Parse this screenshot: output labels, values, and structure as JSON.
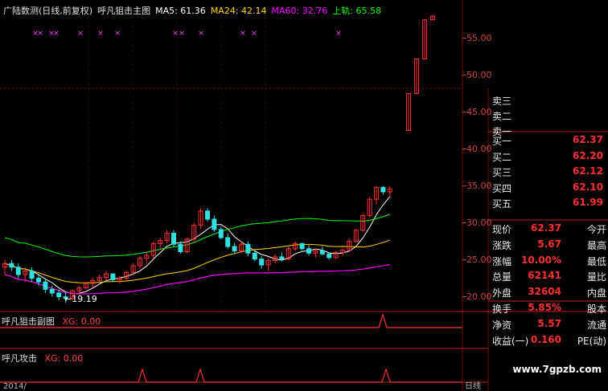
{
  "header": {
    "name": "广陆数测(日线,前复权)",
    "indicator": "呼凡狙击主图",
    "ma5": "MA5: 61.36",
    "ma24": "MA24: 42.14",
    "ma60": "MA60: 32.76",
    "upper": "上轨: 65.58"
  },
  "sub1": {
    "title": "呼凡狙击副图",
    "xg": "XG: 0.00"
  },
  "sub2": {
    "title": "呼凡攻击",
    "xg": "XG: 0.00"
  },
  "low_label": "←19.19",
  "price_axis": [
    "55.00",
    "50.00",
    "45.00",
    "40.00",
    "35.00",
    "30.00",
    "25.00",
    "20.00"
  ],
  "orderbook": {
    "sell": [
      {
        "label": "卖三"
      },
      {
        "label": "卖二"
      },
      {
        "label": "卖一"
      }
    ],
    "buy": [
      {
        "label": "买一",
        "value": "62.37"
      },
      {
        "label": "买二",
        "value": "62.20"
      },
      {
        "label": "买三",
        "value": "62.12"
      },
      {
        "label": "买四",
        "value": "62.10"
      },
      {
        "label": "买五",
        "value": "61.99"
      }
    ]
  },
  "quote": [
    {
      "label": "现价",
      "value": "62.37",
      "label2": "今开"
    },
    {
      "label": "涨跌",
      "value": "5.67",
      "label2": "最高"
    },
    {
      "label": "涨幅",
      "value": "10.00%",
      "label2": "最低"
    },
    {
      "label": "总量",
      "value": "62141",
      "label2": "量比"
    },
    {
      "label": "外盘",
      "value": "32604",
      "label2": "内盘"
    },
    {
      "label": "换手",
      "value": "5.85%",
      "label2": "股本"
    },
    {
      "label": "净资",
      "value": "5.57",
      "label2": "流通"
    },
    {
      "label": "收益(一)",
      "value": "0.160",
      "label2": "PE(动)"
    }
  ],
  "footer": {
    "year": "2014/",
    "period": "日线"
  },
  "watermark": "www.7gpzb.com",
  "colors": {
    "up": "#ff3030",
    "down": "#30e0e0",
    "ma5": "#ffffff",
    "ma24": "#ffd700",
    "ma60": "#ff00ff",
    "upper": "#00ff00",
    "grid": "#7a1010"
  },
  "chart_data": {
    "type": "candlestick",
    "ylim": [
      18,
      58
    ],
    "candles": [
      [
        24,
        25,
        23,
        24.5
      ],
      [
        24.5,
        25,
        23.5,
        24
      ],
      [
        24,
        24.5,
        22.5,
        23
      ],
      [
        23,
        24,
        22,
        23.5
      ],
      [
        23.5,
        24,
        22,
        22.5
      ],
      [
        22.5,
        23,
        21.5,
        22
      ],
      [
        22,
        22.5,
        20.5,
        21
      ],
      [
        21,
        21.5,
        20,
        20.5
      ],
      [
        20.5,
        21,
        19.5,
        20
      ],
      [
        20,
        20.5,
        19.2,
        19.8
      ],
      [
        19.8,
        21,
        19.5,
        20.8
      ],
      [
        20.8,
        21.5,
        20.2,
        21.2
      ],
      [
        21.2,
        22,
        21,
        21.8
      ],
      [
        21.8,
        22.5,
        21.2,
        22.2
      ],
      [
        22.2,
        23,
        21.8,
        22.6
      ],
      [
        22.6,
        23.5,
        22.2,
        23.1
      ],
      [
        23.1,
        23,
        22,
        22.3
      ],
      [
        22.3,
        22.8,
        21.8,
        22.5
      ],
      [
        22.5,
        23.5,
        22.2,
        23.3
      ],
      [
        23.3,
        24.5,
        23,
        24.2
      ],
      [
        24.2,
        25.5,
        23.8,
        25.2
      ],
      [
        25.2,
        26,
        24.5,
        25.6
      ],
      [
        25.6,
        27.5,
        25.2,
        27.2
      ],
      [
        27.2,
        28,
        26.4,
        27.6
      ],
      [
        27.6,
        29,
        27.2,
        28.6
      ],
      [
        28.6,
        29,
        26.8,
        27.1
      ],
      [
        27.1,
        27.5,
        25.8,
        26.1
      ],
      [
        26.1,
        28,
        25.9,
        27.8
      ],
      [
        27.8,
        30,
        27.5,
        29.7
      ],
      [
        29.7,
        32,
        29.2,
        31.6
      ],
      [
        31.6,
        32,
        30.2,
        30.5
      ],
      [
        30.5,
        31,
        28.8,
        29.1
      ],
      [
        29.1,
        29.5,
        27.8,
        28.0
      ],
      [
        28.0,
        28.6,
        26.5,
        26.8
      ],
      [
        26.8,
        27.3,
        25.8,
        26.2
      ],
      [
        26.2,
        27.5,
        25.9,
        27.1
      ],
      [
        27.1,
        27.5,
        25.5,
        25.9
      ],
      [
        25.9,
        26.3,
        24.8,
        25.1
      ],
      [
        25.1,
        25.5,
        23.8,
        24.3
      ],
      [
        24.3,
        25.2,
        23.5,
        24.9
      ],
      [
        24.9,
        25.8,
        24.5,
        25.4
      ],
      [
        25.4,
        26,
        24.8,
        25.1
      ],
      [
        25.1,
        26.8,
        24.9,
        26.5
      ],
      [
        26.5,
        27.5,
        26.2,
        27.2
      ],
      [
        27.2,
        27.3,
        26.3,
        26.5
      ],
      [
        26.5,
        27,
        25.6,
        25.9
      ],
      [
        25.9,
        26.5,
        25.3,
        26.2
      ],
      [
        26.2,
        26.8,
        25.6,
        25.8
      ],
      [
        25.8,
        26,
        25.0,
        25.3
      ],
      [
        25.3,
        26.2,
        25.1,
        26.0
      ],
      [
        26.0,
        26.5,
        25.6,
        26.3
      ],
      [
        26.3,
        27.8,
        26.1,
        27.5
      ],
      [
        27.5,
        29.2,
        27.3,
        29.0
      ],
      [
        29.0,
        31.2,
        28.8,
        31.0
      ],
      [
        31.0,
        33.5,
        30.8,
        33.2
      ],
      [
        33.2,
        35,
        32.5,
        34.8
      ],
      [
        34.8,
        35,
        33.8,
        34.2
      ],
      [
        34.2,
        35,
        33.5,
        34.6
      ],
      [
        42.5,
        47.5,
        42.5,
        47.5
      ],
      [
        47.5,
        52.2,
        47.5,
        52.2
      ],
      [
        52.2,
        57.5,
        52.2,
        57.5
      ],
      [
        57.5,
        58,
        57.5,
        58
      ]
    ]
  }
}
